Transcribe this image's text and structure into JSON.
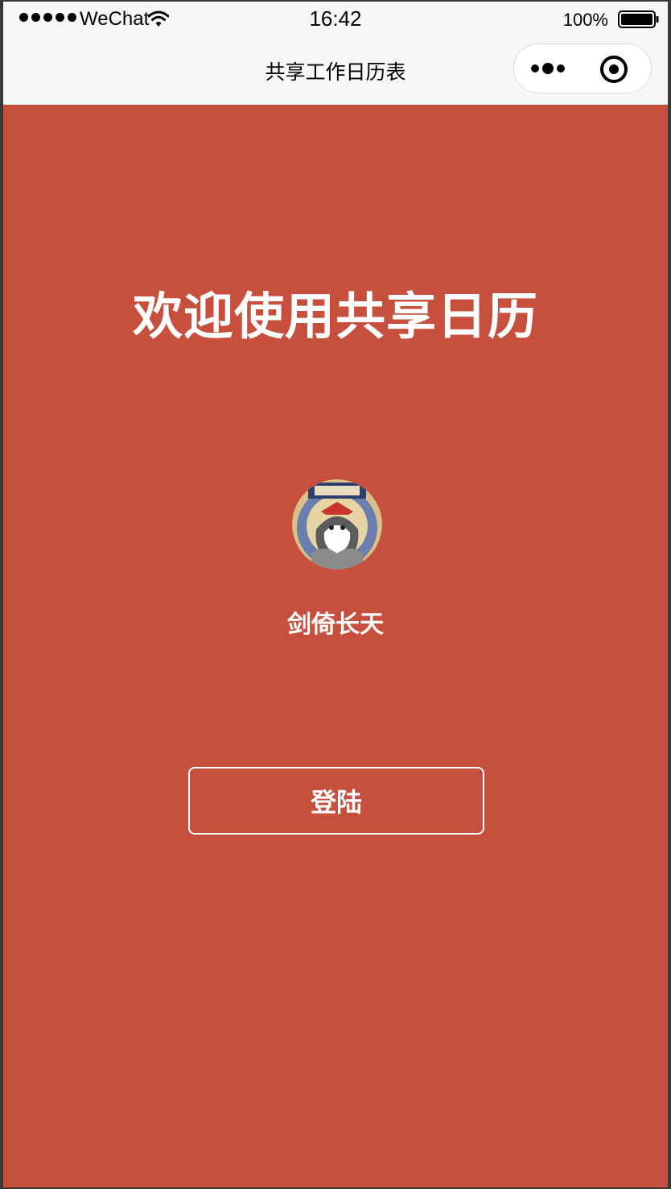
{
  "status_bar": {
    "carrier": "WeChat",
    "time": "16:42",
    "battery_percent": "100%",
    "signal_icon": "signal-dots-icon",
    "wifi_icon": "wifi-icon",
    "battery_icon": "battery-icon"
  },
  "nav_bar": {
    "title": "共享工作日历表",
    "more_icon": "more-dots-icon",
    "close_icon": "target-close-icon"
  },
  "main": {
    "welcome_title": "欢迎使用共享日历",
    "nickname": "剑倚长天",
    "login_label": "登陆"
  },
  "colors": {
    "background": "#c6503d",
    "navbar_background": "#f7f7f7",
    "text_on_background": "#ffffff"
  }
}
